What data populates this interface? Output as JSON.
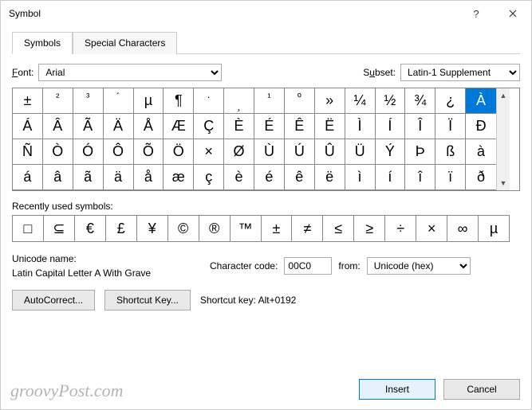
{
  "title": "Symbol",
  "tabs": {
    "symbols": "Symbols",
    "special": "Special Characters"
  },
  "font": {
    "label": "Font:",
    "value": "Arial"
  },
  "subset": {
    "label": "Subset:",
    "value": "Latin-1 Supplement"
  },
  "grid": {
    "rows": [
      [
        "±",
        "²",
        "³",
        "´",
        "µ",
        "¶",
        "·",
        "¸",
        "¹",
        "º",
        "»",
        "¼",
        "½",
        "¾",
        "¿",
        "À"
      ],
      [
        "Á",
        "Â",
        "Ã",
        "Ä",
        "Å",
        "Æ",
        "Ç",
        "È",
        "É",
        "Ê",
        "Ë",
        "Ì",
        "Í",
        "Î",
        "Ï",
        "Ð"
      ],
      [
        "Ñ",
        "Ò",
        "Ó",
        "Ô",
        "Õ",
        "Ö",
        "×",
        "Ø",
        "Ù",
        "Ú",
        "Û",
        "Ü",
        "Ý",
        "Þ",
        "ß",
        "à"
      ],
      [
        "á",
        "â",
        "ã",
        "ä",
        "å",
        "æ",
        "ç",
        "è",
        "é",
        "ê",
        "ë",
        "ì",
        "í",
        "î",
        "ï",
        "ð"
      ]
    ],
    "selected": "À"
  },
  "recent": {
    "label": "Recently used symbols:",
    "items": [
      "□",
      "⊆",
      "€",
      "£",
      "¥",
      "©",
      "®",
      "™",
      "±",
      "≠",
      "≤",
      "≥",
      "÷",
      "×",
      "∞",
      "µ"
    ]
  },
  "unicode": {
    "label": "Unicode name:",
    "name": "Latin Capital Letter A With Grave"
  },
  "charcode": {
    "label": "Character code:",
    "value": "00C0"
  },
  "from": {
    "label": "from:",
    "value": "Unicode (hex)"
  },
  "buttons": {
    "autocorrect": "AutoCorrect...",
    "shortcut": "Shortcut Key...",
    "shortcut_info": "Shortcut key: Alt+0192",
    "insert": "Insert",
    "cancel": "Cancel"
  },
  "watermark": "groovyPost.com"
}
